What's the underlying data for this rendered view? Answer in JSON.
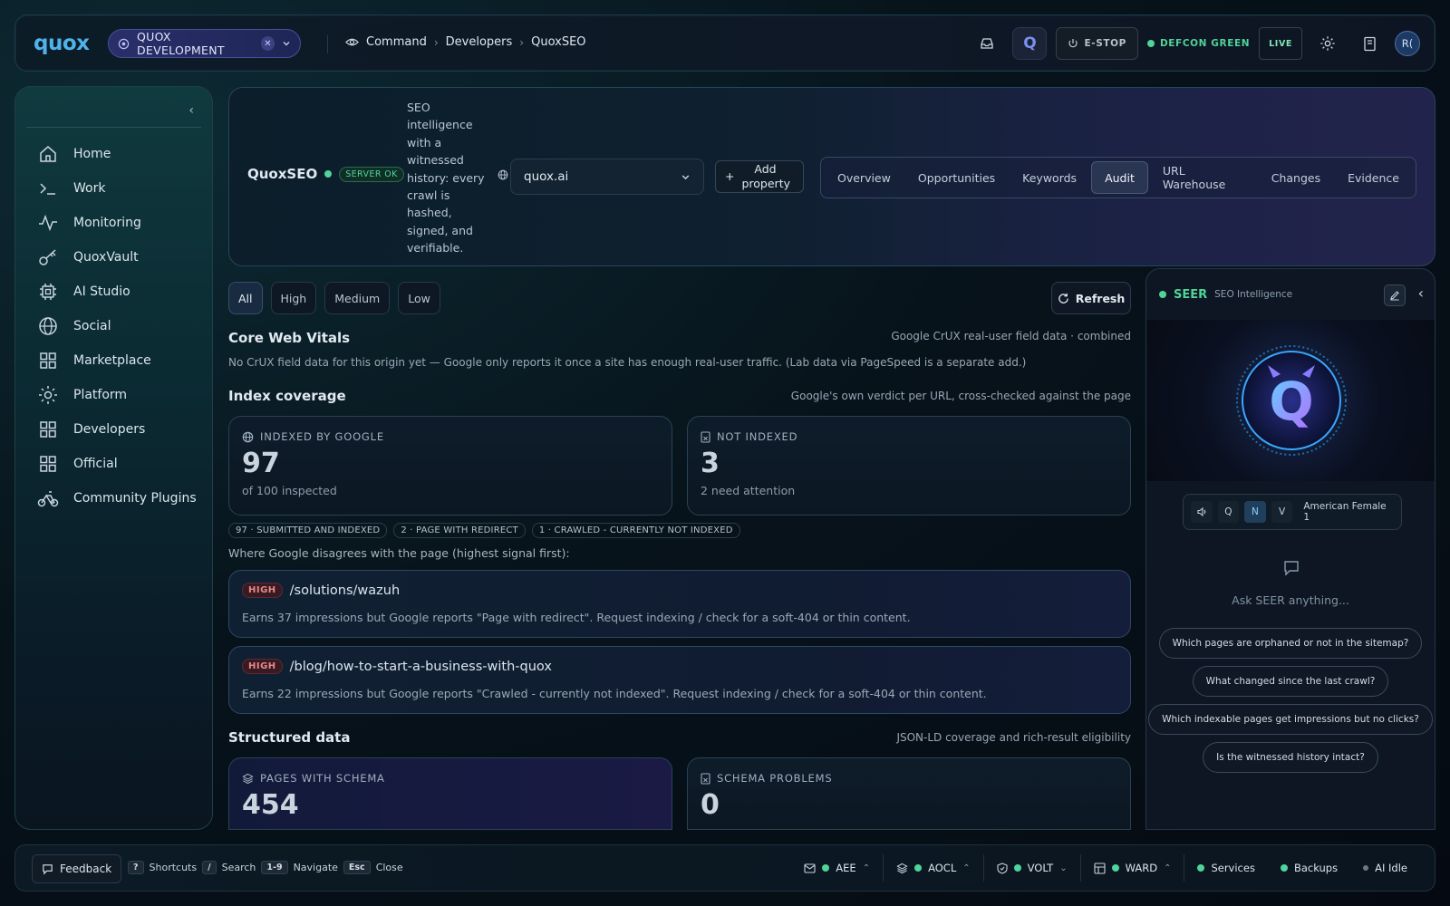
{
  "topbar": {
    "logo": "quox",
    "env": "QUOX DEVELOPMENT",
    "breadcrumb": [
      "Command",
      "Developers",
      "QuoxSEO"
    ],
    "estop": "E-STOP",
    "defcon": "DEFCON GREEN",
    "live": "LIVE",
    "avatar": "R(",
    "q_badge": "Q",
    "colors": {
      "accent": "#4fb3ea",
      "ok": "#4fd49a"
    }
  },
  "sidebar": {
    "items": [
      {
        "label": "Home",
        "icon": "home-icon"
      },
      {
        "label": "Work",
        "icon": "terminal-icon"
      },
      {
        "label": "Monitoring",
        "icon": "activity-icon"
      },
      {
        "label": "QuoxVault",
        "icon": "key-icon"
      },
      {
        "label": "AI Studio",
        "icon": "cpu-icon"
      },
      {
        "label": "Social",
        "icon": "globe-icon"
      },
      {
        "label": "Marketplace",
        "icon": "grid-icon"
      },
      {
        "label": "Platform",
        "icon": "gear-icon"
      },
      {
        "label": "Developers",
        "icon": "grid-icon"
      },
      {
        "label": "Official",
        "icon": "grid-icon"
      },
      {
        "label": "Community Plugins",
        "icon": "bike-icon"
      }
    ]
  },
  "header": {
    "title": "QuoxSEO",
    "status": "SERVER OK",
    "description": "SEO intelligence with a witnessed history: every crawl is hashed, signed, and verifiable.",
    "property": "quox.ai",
    "add_property": "Add property",
    "tabs": [
      "Overview",
      "Opportunities",
      "Keywords",
      "Audit",
      "URL Warehouse",
      "Changes",
      "Evidence"
    ],
    "active_tab": "Audit"
  },
  "filters": {
    "options": [
      "All",
      "High",
      "Medium",
      "Low"
    ],
    "active": "All",
    "refresh": "Refresh"
  },
  "cwv": {
    "title": "Core Web Vitals",
    "note": "Google CrUX real-user field data · combined",
    "body": "No CrUX field data for this origin yet — Google only reports it once a site has enough real-user traffic. (Lab data via PageSpeed is a separate add.)"
  },
  "index": {
    "title": "Index coverage",
    "note": "Google's own verdict per URL, cross-checked against the page",
    "indexed": {
      "label": "INDEXED BY GOOGLE",
      "value": "97",
      "sub": "of 100 inspected"
    },
    "not_indexed": {
      "label": "NOT INDEXED",
      "value": "3",
      "sub": "2 need attention"
    },
    "chips": [
      "97 · SUBMITTED AND INDEXED",
      "2 · PAGE WITH REDIRECT",
      "1 · CRAWLED - CURRENTLY NOT INDEXED"
    ],
    "disagree": "Where Google disagrees with the page (highest signal first):",
    "issues": [
      {
        "severity": "HIGH",
        "path": "/solutions/wazuh",
        "desc": "Earns 37 impressions but Google reports \"Page with redirect\". Request indexing / check for a soft-404 or thin content."
      },
      {
        "severity": "HIGH",
        "path": "/blog/how-to-start-a-business-with-quox",
        "desc": "Earns 22 impressions but Google reports \"Crawled - currently not indexed\". Request indexing / check for a soft-404 or thin content."
      }
    ]
  },
  "structured": {
    "title": "Structured data",
    "note": "JSON-LD coverage and rich-result eligibility",
    "schema": {
      "label": "PAGES WITH SCHEMA",
      "value": "454"
    },
    "problems": {
      "label": "SCHEMA PROBLEMS",
      "value": "0"
    }
  },
  "seer": {
    "name": "SEER",
    "subtitle": "SEO Intelligence",
    "voice_buttons": [
      "Q",
      "N",
      "V"
    ],
    "voice_selected": "N",
    "voice_name": "American Female 1",
    "ask": "Ask SEER anything...",
    "suggestions": [
      "Which pages are orphaned or not in the sitemap?",
      "What changed since the last crawl?",
      "Which indexable pages get impressions but no clicks?",
      "Is the witnessed history intact?"
    ]
  },
  "footer": {
    "feedback": "Feedback",
    "shortcuts": [
      {
        "key": "?",
        "label": "Shortcuts"
      },
      {
        "key": "/",
        "label": "Search"
      },
      {
        "key": "1-9",
        "label": "Navigate"
      },
      {
        "key": "Esc",
        "label": "Close"
      }
    ],
    "status": [
      {
        "label": "AEE",
        "icon": "mail-icon"
      },
      {
        "label": "AOCL",
        "icon": "layers-icon"
      },
      {
        "label": "VOLT",
        "icon": "shield-icon"
      },
      {
        "label": "WARD",
        "icon": "table-icon"
      },
      {
        "label": "Services"
      },
      {
        "label": "Backups"
      },
      {
        "label": "AI Idle"
      }
    ]
  }
}
